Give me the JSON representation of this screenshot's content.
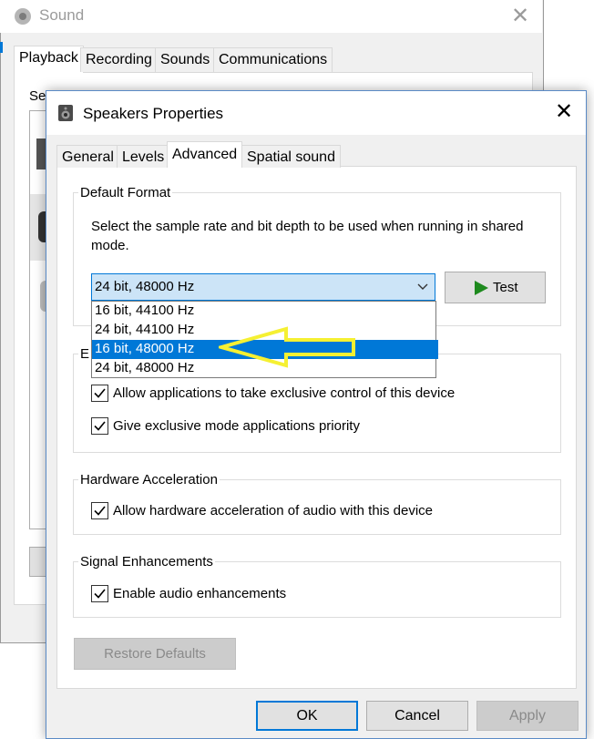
{
  "sound_window": {
    "title": "Sound",
    "tabs": [
      "Playback",
      "Recording",
      "Sounds",
      "Communications"
    ],
    "body_clip_text": "Se"
  },
  "dialog": {
    "title": "Speakers Properties",
    "tabs": [
      "General",
      "Levels",
      "Advanced",
      "Spatial sound"
    ],
    "default_format": {
      "legend": "Default Format",
      "description": "Select the sample rate and bit depth to be used when running in shared mode.",
      "selected_value": "24 bit, 48000 Hz",
      "test_label": "Test",
      "options": [
        "16 bit, 44100 Hz",
        "24 bit, 44100 Hz",
        "16 bit, 48000 Hz",
        "24 bit, 48000 Hz"
      ],
      "highlighted_option_index": 2
    },
    "exclusive_mode": {
      "legend_clip": "E",
      "allow_exclusive": "Allow applications to take exclusive control of this device",
      "exclusive_priority": "Give exclusive mode applications priority"
    },
    "hardware_acceleration": {
      "legend": "Hardware Acceleration",
      "allow_hw": "Allow hardware acceleration of audio with this device"
    },
    "signal_enhancements": {
      "legend": "Signal Enhancements",
      "enable": "Enable audio enhancements"
    },
    "restore_defaults": "Restore Defaults",
    "ok": "OK",
    "cancel": "Cancel",
    "apply": "Apply"
  },
  "colors": {
    "accent": "#0078d7",
    "highlight_arrow": "#f5f032",
    "play_icon": "#1e8a1e"
  }
}
